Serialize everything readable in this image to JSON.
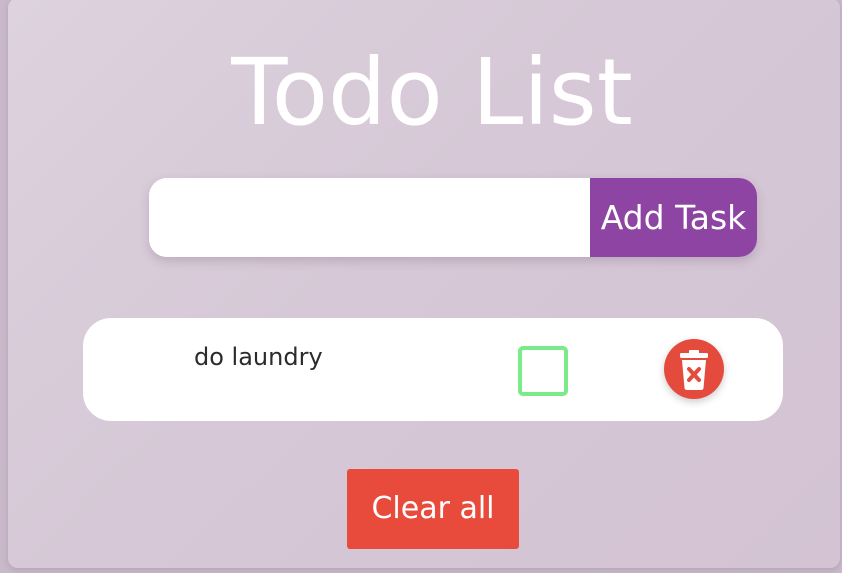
{
  "app": {
    "title": "Todo List"
  },
  "add_form": {
    "input_value": "",
    "input_placeholder": "",
    "add_button_label": "Add Task"
  },
  "tasks": [
    {
      "text": "do laundry",
      "completed": false
    }
  ],
  "icons": {
    "delete": "trash-icon",
    "checkbox": "checkbox-icon"
  },
  "footer": {
    "clear_button_label": "Clear all"
  },
  "colors": {
    "accent": "#8e44a2",
    "danger": "#e84b3c",
    "checkbox_border": "#7bea88",
    "background": "#d6c8d6"
  }
}
